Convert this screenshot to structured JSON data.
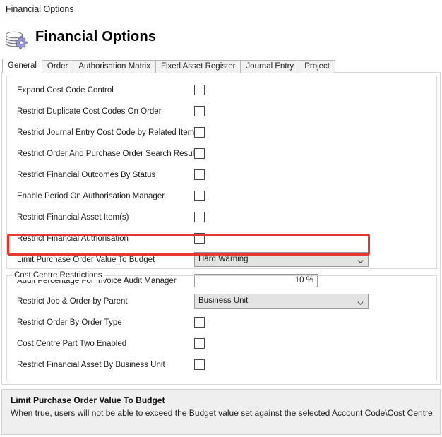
{
  "window": {
    "title": "Financial Options"
  },
  "header": {
    "heading": "Financial Options",
    "icon": "database-gear-icon"
  },
  "tabs": [
    {
      "label": "General",
      "active": true
    },
    {
      "label": "Order",
      "active": false
    },
    {
      "label": "Authorisation Matrix",
      "active": false
    },
    {
      "label": "Fixed Asset Register",
      "active": false
    },
    {
      "label": "Journal Entry",
      "active": false
    },
    {
      "label": "Project",
      "active": false
    }
  ],
  "general_group": {
    "legend": "",
    "rows": [
      {
        "label": "Expand Cost Code Control",
        "control": "checkbox",
        "checked": false
      },
      {
        "label": "Restrict Duplicate Cost Codes On Order",
        "control": "checkbox",
        "checked": false
      },
      {
        "label": "Restrict Journal Entry Cost Code by Related Item",
        "control": "checkbox",
        "checked": false
      },
      {
        "label": "Restrict Order And Purchase Order Search Result",
        "control": "checkbox",
        "checked": false
      },
      {
        "label": "Restrict Financial Outcomes By Status",
        "control": "checkbox",
        "checked": false
      },
      {
        "label": "Enable Period On Authorisation Manager",
        "control": "checkbox",
        "checked": false
      },
      {
        "label": "Restrict Financial Asset Item(s)",
        "control": "checkbox",
        "checked": false
      },
      {
        "label": "Restrict Financial Authorisation",
        "control": "checkbox",
        "checked": false
      },
      {
        "label": "Limit Purchase Order Value To Budget",
        "control": "combobox",
        "value": "Hard Warning",
        "highlighted": true
      },
      {
        "label": "Audit Percentage For Invoice Audit Manager",
        "control": "number",
        "value": "10 %"
      }
    ]
  },
  "cost_centre_group": {
    "legend": "Cost Centre Restrictions",
    "rows": [
      {
        "label": "Restrict Job & Order by Parent",
        "control": "combobox",
        "value": "Business Unit"
      },
      {
        "label": "Restrict Order By Order Type",
        "control": "checkbox",
        "checked": false
      },
      {
        "label": "Cost Centre Part Two Enabled",
        "control": "checkbox",
        "checked": false
      },
      {
        "label": "Restrict Financial Asset By Business Unit",
        "control": "checkbox",
        "checked": false
      }
    ]
  },
  "help_panel": {
    "title": "Limit Purchase Order Value To Budget",
    "body": "When true, users will not be able to exceed the Budget value set against the selected Account Code\\Cost Centre."
  },
  "colors": {
    "highlight": "#e8372c",
    "combo_fill": "#e3e3e3",
    "help_fill": "#efefef",
    "accent_icon": "#8d8cc8"
  }
}
